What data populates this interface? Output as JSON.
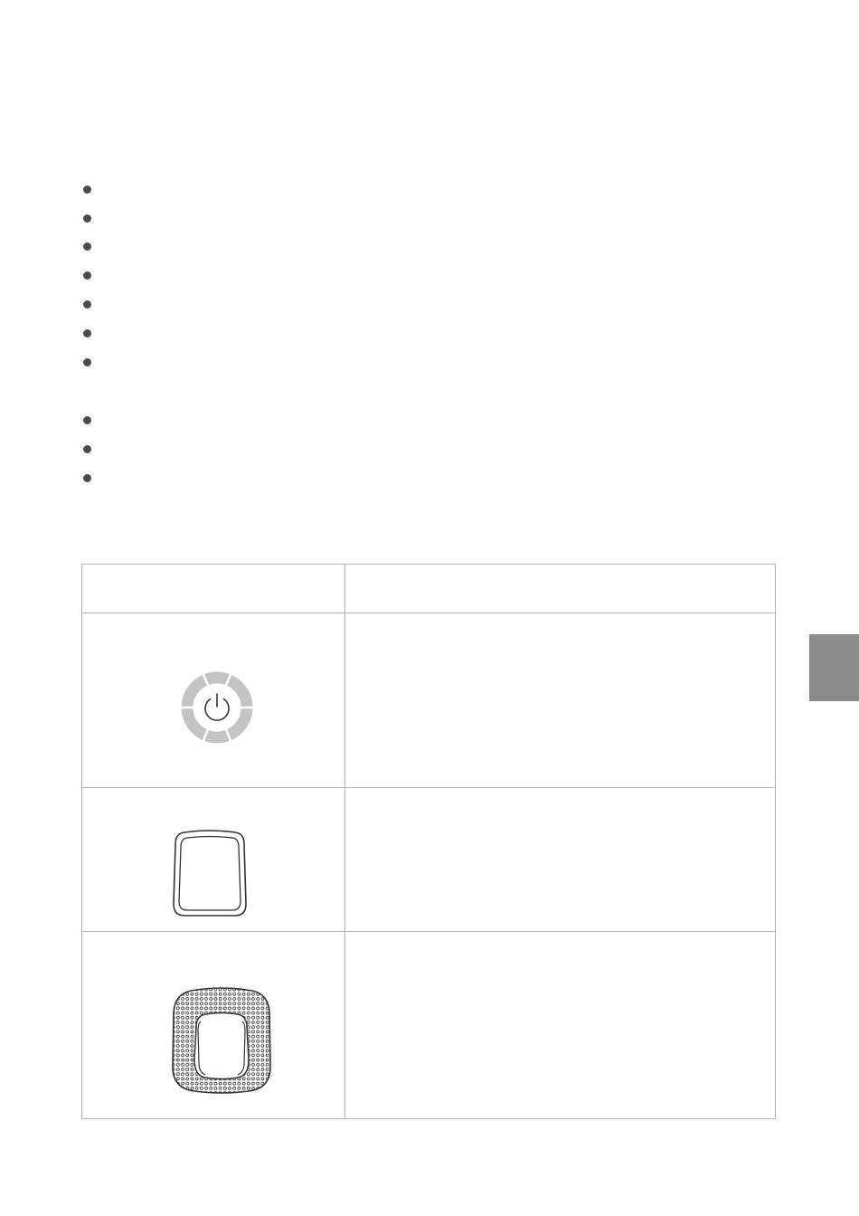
{
  "bullets_group1": [
    "",
    "",
    "",
    "",
    "",
    "",
    ""
  ],
  "bullets_group2": [
    "",
    "",
    ""
  ],
  "table": {
    "header": [
      "",
      ""
    ],
    "rows": [
      {
        "icon": "power-ring-icon",
        "description": ""
      },
      {
        "icon": "rounded-button-icon",
        "description": ""
      },
      {
        "icon": "perforated-grille-icon",
        "description": ""
      }
    ]
  },
  "colors": {
    "ring": "#c4c4c4",
    "line": "#b5b5b5",
    "tab": "#8a8a8a",
    "bullet": "#4a4a4a"
  }
}
